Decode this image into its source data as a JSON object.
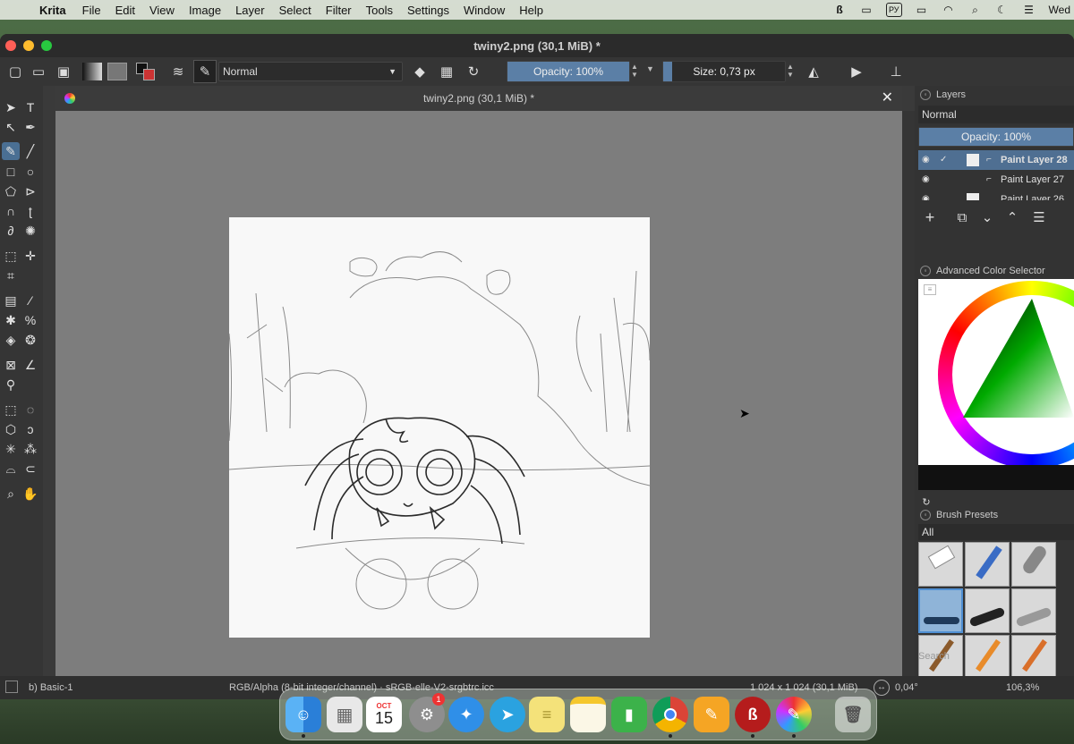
{
  "menubar": {
    "app_name": "Krita",
    "items": [
      "File",
      "Edit",
      "View",
      "Image",
      "Layer",
      "Select",
      "Filter",
      "Tools",
      "Settings",
      "Window",
      "Help"
    ],
    "keyboard_layout": "РУ",
    "clock": "Wed"
  },
  "window": {
    "title": "twiny2.png (30,1 MiB) *"
  },
  "toolbar": {
    "blend_mode": "Normal",
    "opacity": "Opacity: 100%",
    "opacity_fraction": 1.0,
    "size": "Size: 0,73 px"
  },
  "document": {
    "tab_title": "twiny2.png (30,1 MiB) *",
    "close_glyph": "✕"
  },
  "layers": {
    "title": "Layers",
    "blend_mode": "Normal",
    "opacity": "Opacity:  100%",
    "items": [
      {
        "name": "Paint Layer 28",
        "selected": true
      },
      {
        "name": "Paint Layer 27",
        "selected": false
      },
      {
        "name": "Paint Layer 26",
        "selected": false
      }
    ]
  },
  "color_selector": {
    "title": "Advanced Color Selector"
  },
  "brush_presets": {
    "title": "Brush Presets",
    "filter": "All",
    "search_placeholder": "Search"
  },
  "statusbar": {
    "preset": "b) Basic-1",
    "color_info": "RGB/Alpha (8-bit integer/channel) · sRGB-elle-V2-srgbtrc.icc",
    "image_info": "1 024 x 1 024 (30,1 MiB)",
    "rotation": "0,04°",
    "zoom": "106,3%"
  },
  "dock": {
    "calendar_month": "OCT",
    "calendar_day": "15",
    "settings_badge": "1",
    "apps": [
      "finder-icon",
      "launchpad-icon",
      "calendar-icon",
      "system-settings-icon",
      "safari-icon",
      "telegram-icon",
      "stickies-icon",
      "notes-icon",
      "numbers-icon",
      "chrome-icon",
      "pages-icon",
      "vk-icon",
      "krita-icon",
      "trash-icon"
    ]
  }
}
